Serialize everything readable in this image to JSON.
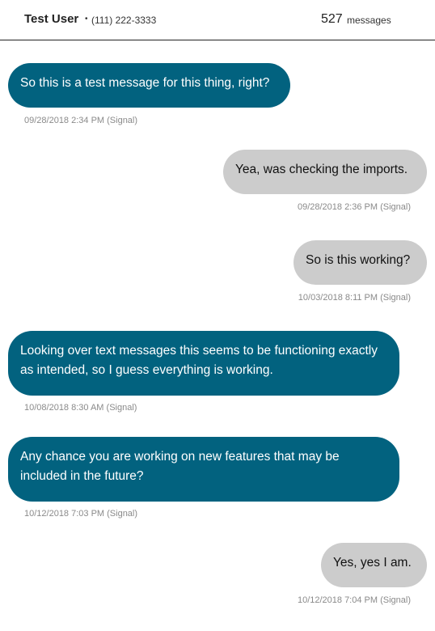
{
  "header": {
    "contact_name": "Test User",
    "separator": "•",
    "phone": "(111) 222-3333",
    "message_count": "527",
    "count_label": "messages"
  },
  "messages": [
    {
      "direction": "incoming",
      "text": "So this is a test message for this thing, right?",
      "meta": "09/28/2018 2:34 PM (Signal)"
    },
    {
      "direction": "outgoing",
      "text": "Yea, was checking the imports.",
      "meta": "09/28/2018 2:36 PM (Signal)"
    },
    {
      "direction": "outgoing",
      "text": "So is this working?",
      "meta": "10/03/2018 8:11 PM (Signal)"
    },
    {
      "direction": "incoming",
      "text": "Looking over text messages this seems to be functioning exactly as intended, so I guess everything is working.",
      "meta": "10/08/2018 8:30 AM (Signal)"
    },
    {
      "direction": "incoming",
      "text": "Any chance you are working on new features that may be included in the future?",
      "meta": "10/12/2018 7:03 PM (Signal)"
    },
    {
      "direction": "outgoing",
      "text": "Yes, yes I am.",
      "meta": "10/12/2018 7:04 PM (Signal)"
    }
  ],
  "colors": {
    "incoming_bubble": "#02627f",
    "outgoing_bubble": "#cccccc",
    "meta_text": "#8a8a8a"
  }
}
